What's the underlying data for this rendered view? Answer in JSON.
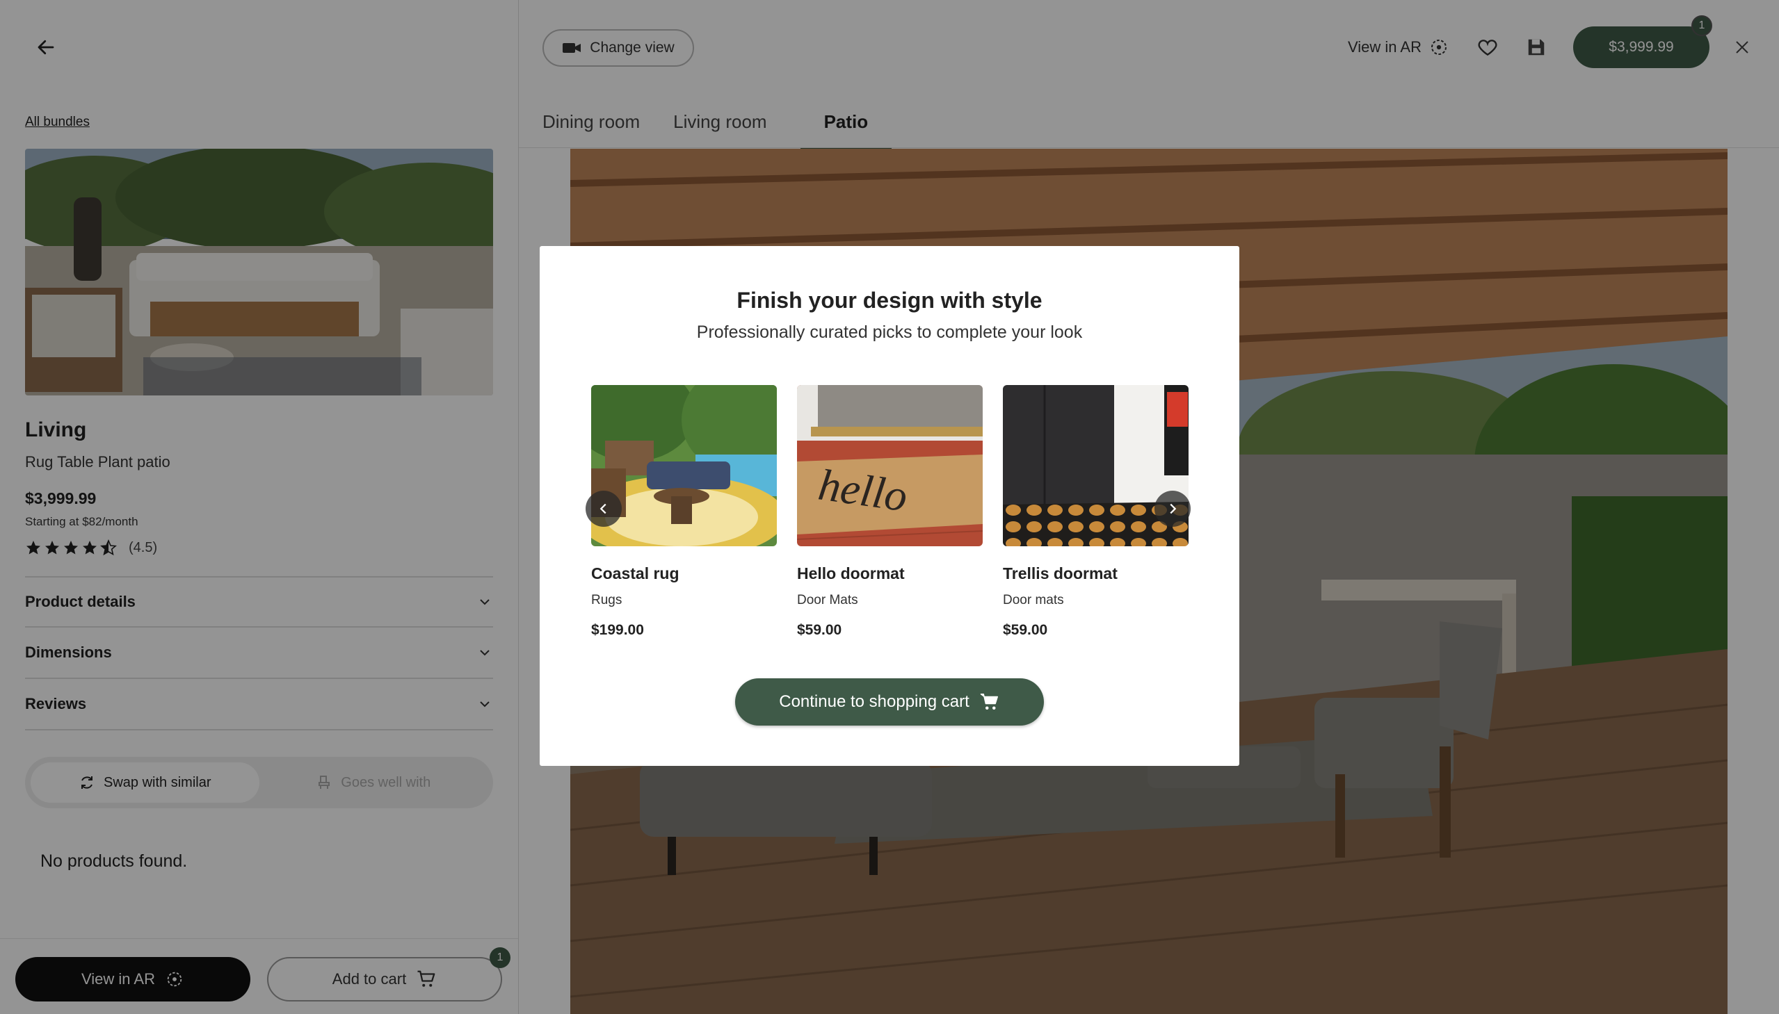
{
  "left_panel": {
    "breadcrumb": "All bundles",
    "product": {
      "title": "Living",
      "subtitle": "Rug Table Plant patio",
      "price": "$3,999.99",
      "monthly": "Starting at $82/month",
      "rating_text": "(4.5)",
      "rating_value": 4.5
    },
    "accordions": [
      {
        "label": "Product details"
      },
      {
        "label": "Dimensions"
      },
      {
        "label": "Reviews"
      }
    ],
    "swap_tabs": {
      "similar": "Swap with similar",
      "goes_well": "Goes well with"
    },
    "empty_message": "No products found.",
    "bottom": {
      "view_ar": "View in AR",
      "add_to_cart": "Add to cart",
      "cart_count": "1"
    }
  },
  "header": {
    "change_view": "Change view",
    "view_ar": "View in AR",
    "price_button": "$3,999.99",
    "cart_count": "1"
  },
  "tabs": [
    {
      "label": "Dining room",
      "active": false
    },
    {
      "label": "Living room",
      "active": false
    },
    {
      "label": "Patio",
      "active": true
    }
  ],
  "modal": {
    "title": "Finish your design with style",
    "subtitle": "Professionally curated picks to complete your look",
    "products": [
      {
        "name": "Coastal rug",
        "category": "Rugs",
        "price": "$199.00"
      },
      {
        "name": "Hello doormat",
        "category": "Door Mats",
        "price": "$59.00"
      },
      {
        "name": "Trellis doormat",
        "category": "Door mats",
        "price": "$59.00"
      }
    ],
    "doormat_text": "hello",
    "continue_button": "Continue to shopping cart"
  },
  "colors": {
    "accent": "#3f5a48",
    "overlay": "rgba(0,0,0,0.42)"
  }
}
